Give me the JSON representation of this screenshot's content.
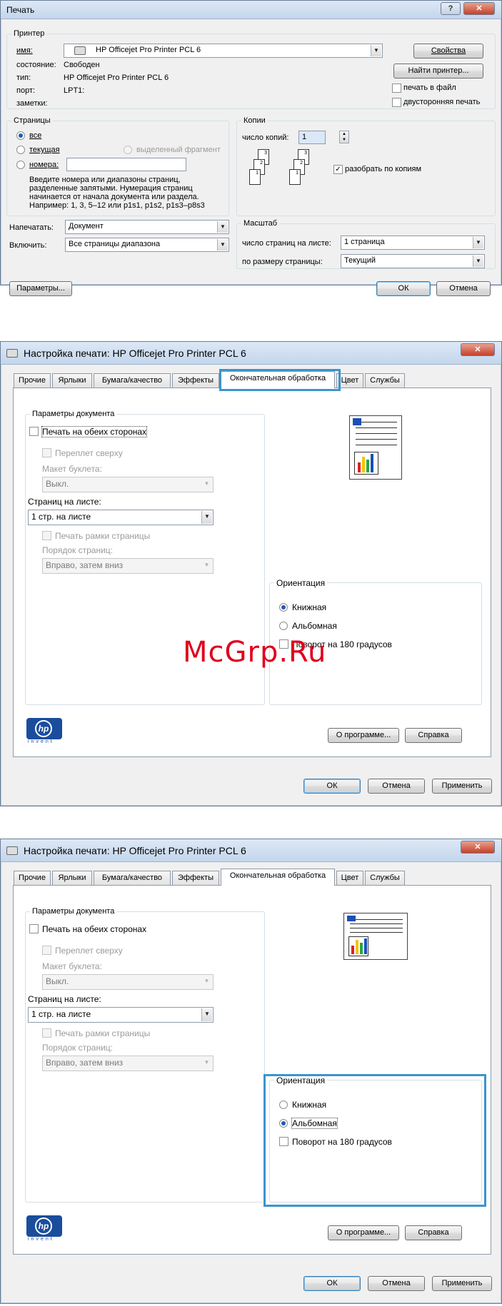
{
  "print_dialog": {
    "title": "Печать",
    "printer_group": "Принтер",
    "name_label": "имя:",
    "printer_name": "HP Officejet Pro  Printer PCL 6",
    "status_label": "состояние:",
    "status_value": "Свободен",
    "type_label": "тип:",
    "type_value": "HP Officejet Pro  Printer PCL 6",
    "port_label": "порт:",
    "port_value": "LPT1:",
    "notes_label": "заметки:",
    "properties_button": "Свойства",
    "find_printer_button": "Найти принтер...",
    "print_to_file": "печать в файл",
    "duplex": "двусторонняя печать",
    "pages_group": "Страницы",
    "all": "все",
    "current": "текущая",
    "selection": "выделенный фрагмент",
    "pages_radio": "номера:",
    "pages_help": [
      "Введите номера или диапазоны страниц,",
      "разделенные запятыми. Нумерация страниц",
      "начинается от начала документа или раздела.",
      "Например: 1, 3, 5–12 или p1s1, p1s2, p1s3–p8s3"
    ],
    "copies_group": "Копии",
    "copies_label": "число копий:",
    "copies_value": "1",
    "collate": "разобрать по копиям",
    "print_what_label": "Напечатать:",
    "print_what_value": "Документ",
    "include_label": "Включить:",
    "include_value": "Все страницы диапазона",
    "zoom_group": "Масштаб",
    "pages_per_sheet_label": "число страниц на листе:",
    "pages_per_sheet_value": "1 страница",
    "scale_label": "по размеру страницы:",
    "scale_value": "Текущий",
    "options_button": "Параметры...",
    "ok_button": "ОК",
    "cancel_button": "Отмена"
  },
  "prefs": {
    "title": "Настройка печати: HP Officejet Pro  Printer PCL 6",
    "tabs": [
      "Прочие",
      "Ярлыки",
      "Бумага/качество",
      "Эффекты",
      "Окончательная обработка",
      "Цвет",
      "Службы"
    ],
    "doc_options_group": "Параметры документа",
    "duplex": "Печать на обеих сторонах",
    "flip_up": "Переплет сверху",
    "booklet_label": "Макет буклета:",
    "booklet_value": "Выкл.",
    "pages_per_sheet_label": "Страниц на листе:",
    "pages_per_sheet_value": "1 стр. на листе",
    "print_borders": "Печать рамки страницы",
    "page_order_label": "Порядок страниц:",
    "page_order_value": "Вправо, затем вниз",
    "orientation_group": "Ориентация",
    "portrait": "Книжная",
    "landscape": "Альбомная",
    "rotate": "Поворот на 180 градусов",
    "about_button": "О программе...",
    "help_button": "Справка",
    "ok_button": "ОК",
    "cancel_button": "Отмена",
    "apply_button": "Применить",
    "hp_logo_text": "invent"
  },
  "watermark": "McGrp.Ru",
  "colors": {
    "highlight": "#3a94d0",
    "accent": "#1d5bb4",
    "watermark": "#e0001b"
  }
}
